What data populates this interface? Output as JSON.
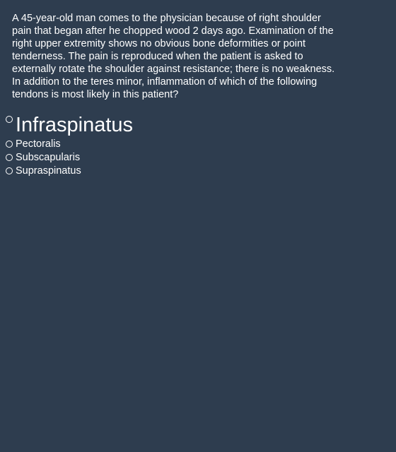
{
  "question": {
    "text": "A 45-year-old man comes to the physician because of right shoulder pain that began after he chopped wood 2 days ago. Examination of the right upper extremity shows no obvious bone deformities or point tenderness. The pain is reproduced when the patient is asked to externally rotate the shoulder against resistance; there is no weakness. In addition to the teres minor, inflammation of which of the following tendons is most likely in this patient?"
  },
  "options": [
    {
      "label": "Infraspinatus"
    },
    {
      "label": "Pectoralis"
    },
    {
      "label": "Subscapularis"
    },
    {
      "label": "Supraspinatus"
    }
  ],
  "colors": {
    "background": "#2e3d4f",
    "text": "#ffffff"
  }
}
